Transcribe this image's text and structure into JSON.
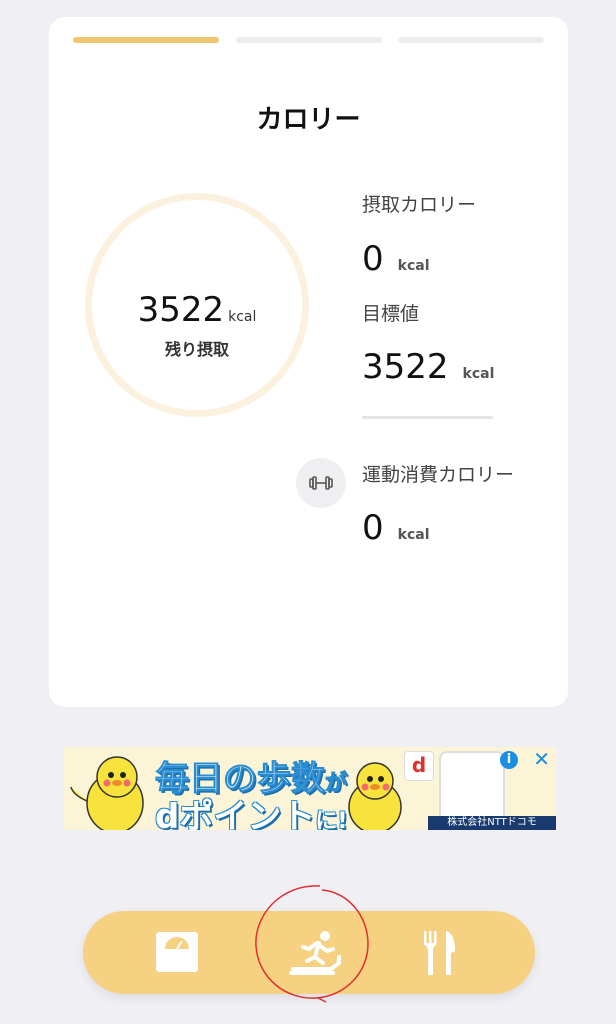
{
  "card": {
    "tabs": [
      {
        "name": "calorie",
        "active": true
      },
      {
        "name": "second",
        "active": false
      },
      {
        "name": "third",
        "active": false
      }
    ],
    "title": "カロリー",
    "remaining": {
      "value": "3522",
      "unit": "kcal",
      "label": "残り摂取"
    },
    "intake": {
      "label": "摂取カロリー",
      "value": "0",
      "unit": "kcal"
    },
    "target": {
      "label": "目標値",
      "value": "3522",
      "unit": "kcal"
    },
    "exercise": {
      "label": "運動消費カロリー",
      "value": "0",
      "unit": "kcal",
      "icon": "dumbbell-icon"
    }
  },
  "ad": {
    "line1": "毎日の歩数",
    "line1_suffix": "が",
    "line2": "dポイント",
    "line2_suffix": "に!",
    "company": "株式会社NTTドコモ",
    "d_logo": "d",
    "info": "i",
    "close": "✕"
  },
  "navbar": {
    "items": [
      {
        "icon": "scale-icon"
      },
      {
        "icon": "running-treadmill-icon"
      },
      {
        "icon": "fork-knife-icon"
      }
    ],
    "background": "#f5d181"
  },
  "colors": {
    "accent": "#efc770",
    "ring": "#fcf1de",
    "annotation": "#e03030"
  }
}
